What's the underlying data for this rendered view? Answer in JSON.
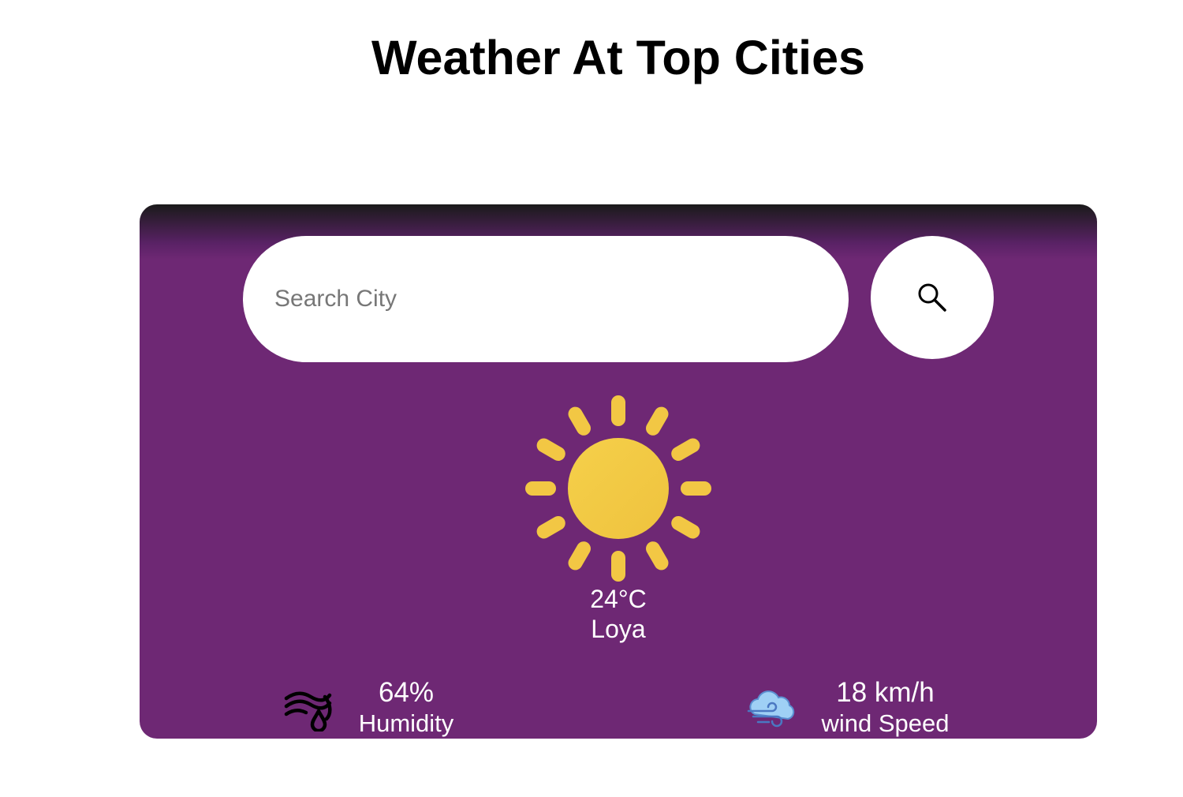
{
  "page": {
    "title": "Weather At Top Cities"
  },
  "search": {
    "placeholder": "Search City",
    "value": "",
    "button_icon": "search-icon"
  },
  "weather": {
    "icon": "sun-icon",
    "temperature": "24°C",
    "city": "Loya"
  },
  "stats": {
    "humidity": {
      "icon": "humidity-icon",
      "value": "64%",
      "label": "Humidity"
    },
    "wind": {
      "icon": "wind-cloud-icon",
      "value": "18 km/h",
      "label": "wind Speed"
    }
  },
  "colors": {
    "card_background": "#6e2874",
    "card_top_shade": "#1a1a1a",
    "sun": "#f2c744",
    "text_on_card": "#ffffff",
    "title_text": "#000000"
  }
}
